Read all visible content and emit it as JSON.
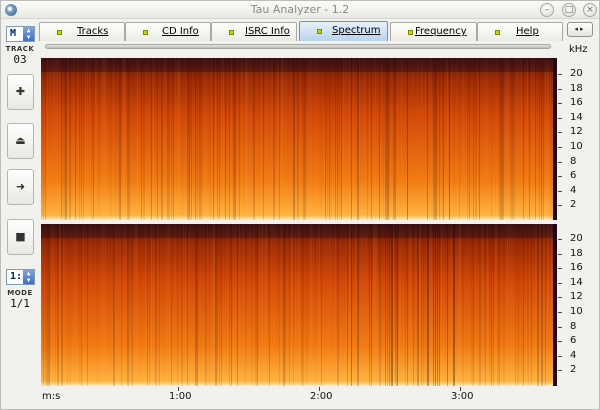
{
  "window": {
    "title": "Tau Analyzer - 1.2",
    "min_glyph": "–",
    "max_glyph": "□",
    "close_glyph": "×"
  },
  "left_panel": {
    "track_label": "TRACK",
    "track_value": "03",
    "mode_label": "MODE",
    "mode_value": "1/1",
    "top_selector": "M",
    "bottom_selector": "1:",
    "buttons": [
      {
        "name": "add",
        "glyph": "✚"
      },
      {
        "name": "eject",
        "glyph": "⏏"
      },
      {
        "name": "play",
        "glyph": "➜"
      },
      {
        "name": "stop",
        "glyph": "■"
      }
    ]
  },
  "tabs": [
    {
      "label": "Tracks"
    },
    {
      "label": "CD Info"
    },
    {
      "label": "ISRC Info"
    },
    {
      "label": "Spectrum",
      "active": true
    },
    {
      "label": "Frequency"
    },
    {
      "label": "Help"
    }
  ],
  "tab_scroll_glyph": "◂▸",
  "frequency_axis": {
    "unit": "kHz",
    "ticks": [
      "20",
      "18",
      "16",
      "14",
      "12",
      "10",
      "8",
      "6",
      "4",
      "2"
    ]
  },
  "time_axis": {
    "unit": "m:s",
    "labels": [
      "1:00",
      "2:00",
      "3:00"
    ]
  },
  "spectrogram": {
    "colors": [
      "#1b0a18",
      "#4a1410",
      "#9a2a05",
      "#d04808",
      "#f07a14",
      "#ffb340"
    ],
    "channels": 2
  }
}
